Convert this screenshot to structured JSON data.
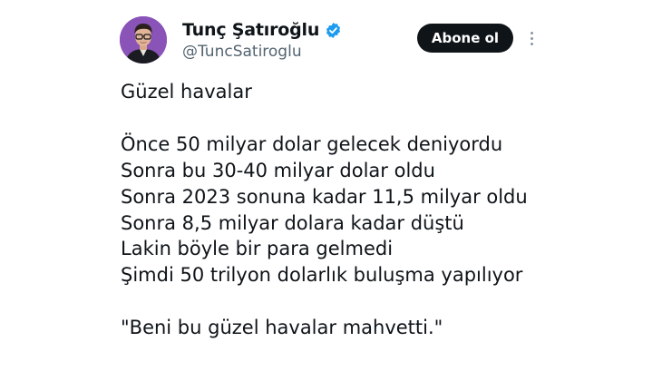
{
  "author": {
    "display_name": "Tunç Şatıroğlu",
    "handle": "@TuncSatiroglu",
    "verified": true,
    "avatar_bg": "#8a53b8"
  },
  "actions": {
    "follow_label": "Abone ol",
    "more_icon": "more-vertical-icon"
  },
  "tweet": {
    "title_line": "Güzel havalar",
    "lines": [
      "Önce 50 milyar dolar gelecek deniyordu",
      "Sonra bu 30-40 milyar dolar oldu",
      "Sonra 2023 sonuna kadar 11,5 milyar oldu",
      "Sonra 8,5 milyar dolara kadar düştü",
      "Lakin böyle bir para gelmedi",
      "Şimdi 50 trilyon dolarlık buluşma yapılıyor"
    ],
    "quote": "\"Beni bu güzel havalar mahvetti.\""
  },
  "colors": {
    "text": "#0f1419",
    "secondary": "#536471",
    "verified_blue": "#1d9bf0",
    "button_bg": "#0f1419"
  }
}
